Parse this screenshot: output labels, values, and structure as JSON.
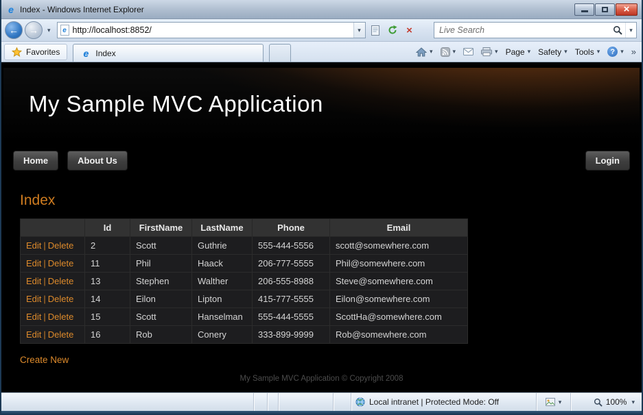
{
  "window": {
    "title": "Index - Windows Internet Explorer"
  },
  "nav": {
    "url": "http://localhost:8852/",
    "search_placeholder": "Live Search"
  },
  "favorites_bar": {
    "favorites_label": "Favorites",
    "tab_label": "Index"
  },
  "command_bar": {
    "page_label": "Page",
    "safety_label": "Safety",
    "tools_label": "Tools"
  },
  "site": {
    "header_title": "My Sample MVC Application",
    "menu": [
      {
        "label": "Home"
      },
      {
        "label": "About Us"
      }
    ],
    "login_label": "Login",
    "footer_text": "My Sample MVC Application © Copyright 2008"
  },
  "content": {
    "heading": "Index",
    "create_new_label": "Create New"
  },
  "table": {
    "headers": {
      "id": "Id",
      "first_name": "FirstName",
      "last_name": "LastName",
      "phone": "Phone",
      "email": "Email"
    },
    "actions": {
      "edit": "Edit",
      "separator": "|",
      "delete": "Delete"
    },
    "rows": [
      {
        "id": "2",
        "first_name": "Scott",
        "last_name": "Guthrie",
        "phone": "555-444-5556",
        "email": "scott@somewhere.com"
      },
      {
        "id": "11",
        "first_name": "Phil",
        "last_name": "Haack",
        "phone": "206-777-5555",
        "email": "Phil@somewhere.com"
      },
      {
        "id": "13",
        "first_name": "Stephen",
        "last_name": "Walther",
        "phone": "206-555-8988",
        "email": "Steve@somewhere.com"
      },
      {
        "id": "14",
        "first_name": "Eilon",
        "last_name": "Lipton",
        "phone": "415-777-5555",
        "email": "Eilon@somewhere.com"
      },
      {
        "id": "15",
        "first_name": "Scott",
        "last_name": "Hanselman",
        "phone": "555-444-5555",
        "email": "ScottHa@somewhere.com"
      },
      {
        "id": "16",
        "first_name": "Rob",
        "last_name": "Conery",
        "phone": "333-899-9999",
        "email": "Rob@somewhere.com"
      }
    ]
  },
  "status_bar": {
    "zone_text": "Local intranet | Protected Mode: Off",
    "zoom_level": "100%"
  },
  "theme": {
    "accent_orange": "#dd8a2b",
    "page_background": "#000000"
  }
}
